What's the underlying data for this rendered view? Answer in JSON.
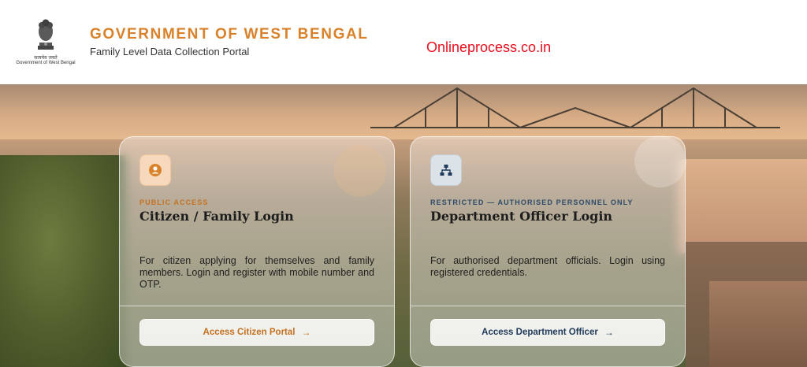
{
  "header": {
    "emblem_hindi": "सत्यमेव जयते",
    "emblem_caption": "Government of West Bengal",
    "title": "GOVERNMENT OF WEST BENGAL",
    "subtitle": "Family Level Data Collection Portal",
    "watermark": "Onlineprocess.co.in"
  },
  "cards": {
    "citizen": {
      "icon": "user-icon",
      "access_label": "PUBLIC ACCESS",
      "title": "Citizen / Family Login",
      "description": "For citizen applying for themselves and family members. Login and register with mobile number and OTP.",
      "button_label": "Access Citizen Portal",
      "button_arrow": "→"
    },
    "officer": {
      "icon": "org-chart-icon",
      "access_label": "RESTRICTED — AUTHORISED PERSONNEL ONLY",
      "title": "Department Officer Login",
      "description": "For authorised department officials. Login using registered credentials.",
      "button_label": "Access Department Officer",
      "button_arrow": "→"
    }
  },
  "colors": {
    "accent_orange": "#d9822b",
    "navy": "#1f3a5a",
    "watermark_red": "#e8101f"
  }
}
